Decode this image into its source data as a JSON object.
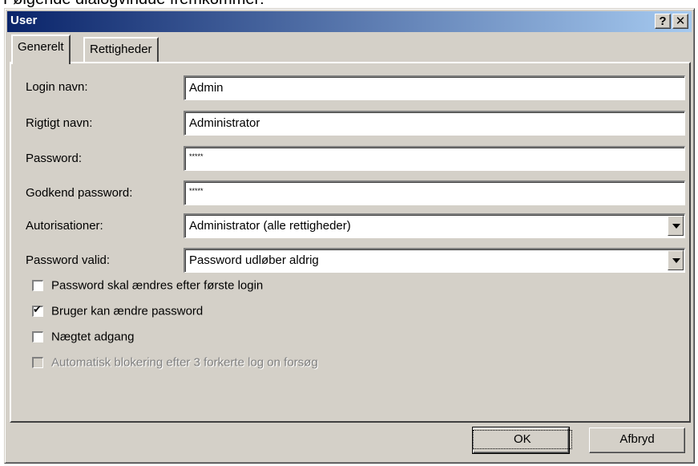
{
  "caption": "Følgende dialogvindue fremkommer:",
  "window": {
    "title": "User",
    "help_label": "?",
    "close_label": "✕"
  },
  "tabs": [
    {
      "label": "Generelt",
      "active": true
    },
    {
      "label": "Rettigheder",
      "active": false
    }
  ],
  "form": {
    "login_label": "Login navn:",
    "login_value": "Admin",
    "realname_label": "Rigtigt navn:",
    "realname_value": "Administrator",
    "password_label": "Password:",
    "password_value": "*****",
    "confirm_label": "Godkend password:",
    "confirm_value": "*****",
    "auth_label": "Autorisationer:",
    "auth_value": "Administrator (alle rettigheder)",
    "valid_label": "Password valid:",
    "valid_value": "Password udløber aldrig"
  },
  "checkboxes": [
    {
      "label": "Password skal ændres efter første login",
      "checked": false,
      "enabled": true
    },
    {
      "label": "Bruger kan ændre password",
      "checked": true,
      "enabled": true
    },
    {
      "label": "Nægtet adgang",
      "checked": false,
      "enabled": true
    },
    {
      "label": "Automatisk blokering efter 3 forkerte log on forsøg",
      "checked": false,
      "enabled": false
    }
  ],
  "buttons": {
    "ok_label": "OK",
    "cancel_label": "Afbryd"
  }
}
